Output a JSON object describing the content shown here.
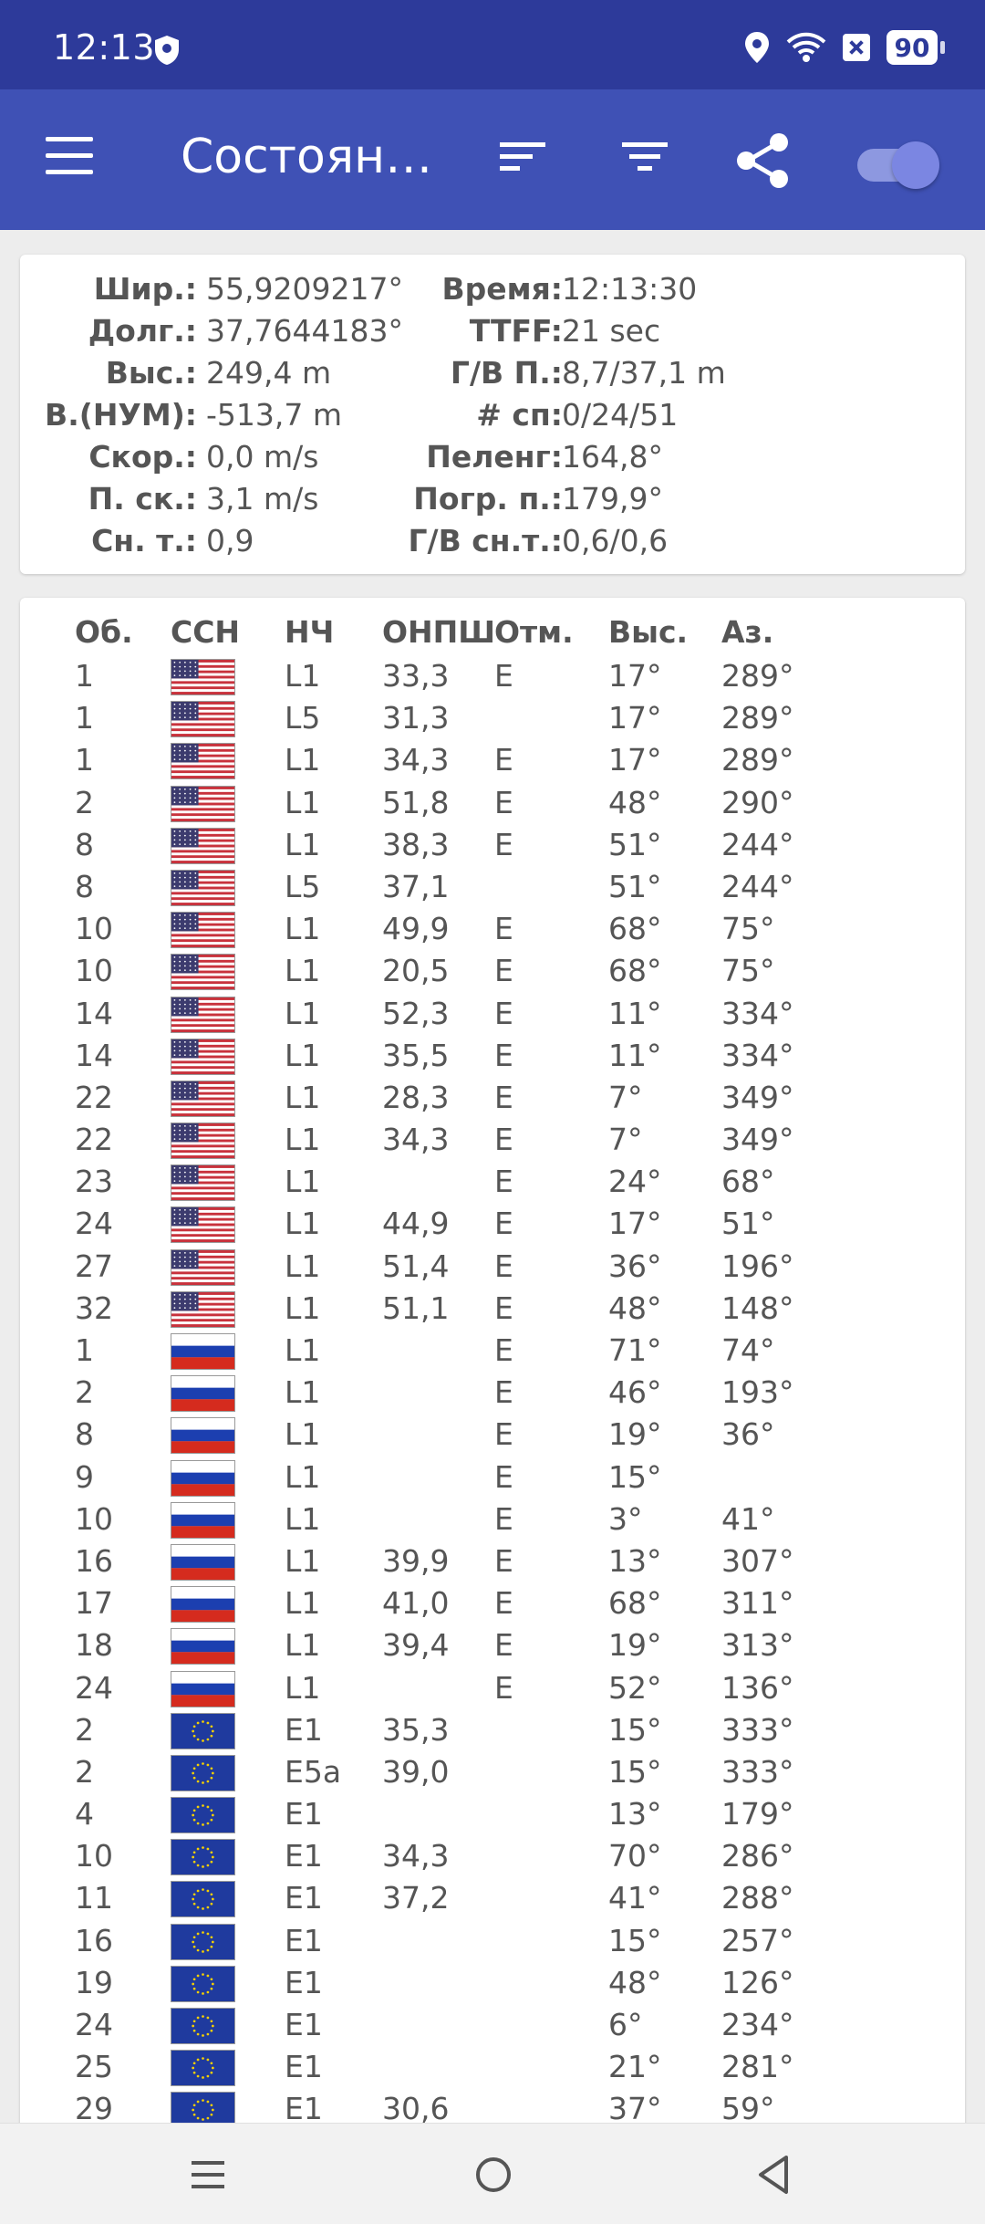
{
  "status_bar": {
    "time": "12:13",
    "battery": "90",
    "icons": [
      "shield-icon",
      "location-icon",
      "wifi-icon",
      "close-box-icon",
      "battery-icon"
    ]
  },
  "app_bar": {
    "title": "Состоян…",
    "icons": [
      "menu-icon",
      "sort-icon",
      "filter-icon",
      "share-icon",
      "toggle-switch"
    ],
    "toggle_on": true,
    "color": "#3f51b5"
  },
  "info": {
    "left": [
      {
        "label": "Шир.:",
        "value": "55,9209217°"
      },
      {
        "label": "Долг.:",
        "value": "37,7644183°"
      },
      {
        "label": "Выс.:",
        "value": "249,4 m"
      },
      {
        "label": "В.(НУМ):",
        "value": "-513,7 m"
      },
      {
        "label": "Скор.:",
        "value": "0,0 m/s"
      },
      {
        "label": "П. ск.:",
        "value": "3,1 m/s"
      },
      {
        "label": "Сн. т.:",
        "value": "0,9"
      }
    ],
    "right": [
      {
        "label": "Время:",
        "value": "12:13:30"
      },
      {
        "label": "TTFF:",
        "value": "21 sec"
      },
      {
        "label": "Г/В П.:",
        "value": "8,7/37,1 m"
      },
      {
        "label": "# сп:",
        "value": "0/24/51"
      },
      {
        "label": "Пеленг:",
        "value": "164,8°"
      },
      {
        "label": "Погр. п.:",
        "value": "179,9°"
      },
      {
        "label": "Г/В сн.т.:",
        "value": "0,6/0,6"
      }
    ]
  },
  "table": {
    "headers": [
      "Об.",
      "ССН",
      "НЧ",
      "ОНПШ",
      "Отм.",
      "Выс.",
      "Аз."
    ],
    "rows": [
      {
        "id": "1",
        "flag": "us",
        "freq": "L1",
        "cn0": "33,3",
        "flags": "E",
        "elev": "17°",
        "az": "289°"
      },
      {
        "id": "1",
        "flag": "us",
        "freq": "L5",
        "cn0": "31,3",
        "flags": "",
        "elev": "17°",
        "az": "289°"
      },
      {
        "id": "1",
        "flag": "us",
        "freq": "L1",
        "cn0": "34,3",
        "flags": "E",
        "elev": "17°",
        "az": "289°"
      },
      {
        "id": "2",
        "flag": "us",
        "freq": "L1",
        "cn0": "51,8",
        "flags": "E",
        "elev": "48°",
        "az": "290°"
      },
      {
        "id": "8",
        "flag": "us",
        "freq": "L1",
        "cn0": "38,3",
        "flags": "E",
        "elev": "51°",
        "az": "244°"
      },
      {
        "id": "8",
        "flag": "us",
        "freq": "L5",
        "cn0": "37,1",
        "flags": "",
        "elev": "51°",
        "az": "244°"
      },
      {
        "id": "10",
        "flag": "us",
        "freq": "L1",
        "cn0": "49,9",
        "flags": "E",
        "elev": "68°",
        "az": "75°"
      },
      {
        "id": "10",
        "flag": "us",
        "freq": "L1",
        "cn0": "20,5",
        "flags": "E",
        "elev": "68°",
        "az": "75°"
      },
      {
        "id": "14",
        "flag": "us",
        "freq": "L1",
        "cn0": "52,3",
        "flags": "E",
        "elev": "11°",
        "az": "334°"
      },
      {
        "id": "14",
        "flag": "us",
        "freq": "L1",
        "cn0": "35,5",
        "flags": "E",
        "elev": "11°",
        "az": "334°"
      },
      {
        "id": "22",
        "flag": "us",
        "freq": "L1",
        "cn0": "28,3",
        "flags": "E",
        "elev": "7°",
        "az": "349°"
      },
      {
        "id": "22",
        "flag": "us",
        "freq": "L1",
        "cn0": "34,3",
        "flags": "E",
        "elev": "7°",
        "az": "349°"
      },
      {
        "id": "23",
        "flag": "us",
        "freq": "L1",
        "cn0": "",
        "flags": "E",
        "elev": "24°",
        "az": "68°"
      },
      {
        "id": "24",
        "flag": "us",
        "freq": "L1",
        "cn0": "44,9",
        "flags": "E",
        "elev": "17°",
        "az": "51°"
      },
      {
        "id": "27",
        "flag": "us",
        "freq": "L1",
        "cn0": "51,4",
        "flags": "E",
        "elev": "36°",
        "az": "196°"
      },
      {
        "id": "32",
        "flag": "us",
        "freq": "L1",
        "cn0": "51,1",
        "flags": "E",
        "elev": "48°",
        "az": "148°"
      },
      {
        "id": "1",
        "flag": "ru",
        "freq": "L1",
        "cn0": "",
        "flags": "E",
        "elev": "71°",
        "az": "74°"
      },
      {
        "id": "2",
        "flag": "ru",
        "freq": "L1",
        "cn0": "",
        "flags": "E",
        "elev": "46°",
        "az": "193°"
      },
      {
        "id": "8",
        "flag": "ru",
        "freq": "L1",
        "cn0": "",
        "flags": "E",
        "elev": "19°",
        "az": "36°"
      },
      {
        "id": "9",
        "flag": "ru",
        "freq": "L1",
        "cn0": "",
        "flags": "E",
        "elev": "15°",
        "az": ""
      },
      {
        "id": "10",
        "flag": "ru",
        "freq": "L1",
        "cn0": "",
        "flags": "E",
        "elev": "3°",
        "az": "41°"
      },
      {
        "id": "16",
        "flag": "ru",
        "freq": "L1",
        "cn0": "39,9",
        "flags": "E",
        "elev": "13°",
        "az": "307°"
      },
      {
        "id": "17",
        "flag": "ru",
        "freq": "L1",
        "cn0": "41,0",
        "flags": "E",
        "elev": "68°",
        "az": "311°"
      },
      {
        "id": "18",
        "flag": "ru",
        "freq": "L1",
        "cn0": "39,4",
        "flags": "E",
        "elev": "19°",
        "az": "313°"
      },
      {
        "id": "24",
        "flag": "ru",
        "freq": "L1",
        "cn0": "",
        "flags": "E",
        "elev": "52°",
        "az": "136°"
      },
      {
        "id": "2",
        "flag": "eu",
        "freq": "E1",
        "cn0": "35,3",
        "flags": "",
        "elev": "15°",
        "az": "333°"
      },
      {
        "id": "2",
        "flag": "eu",
        "freq": "E5a",
        "cn0": "39,0",
        "flags": "",
        "elev": "15°",
        "az": "333°"
      },
      {
        "id": "4",
        "flag": "eu",
        "freq": "E1",
        "cn0": "",
        "flags": "",
        "elev": "13°",
        "az": "179°"
      },
      {
        "id": "10",
        "flag": "eu",
        "freq": "E1",
        "cn0": "34,3",
        "flags": "",
        "elev": "70°",
        "az": "286°"
      },
      {
        "id": "11",
        "flag": "eu",
        "freq": "E1",
        "cn0": "37,2",
        "flags": "",
        "elev": "41°",
        "az": "288°"
      },
      {
        "id": "16",
        "flag": "eu",
        "freq": "E1",
        "cn0": "",
        "flags": "",
        "elev": "15°",
        "az": "257°"
      },
      {
        "id": "19",
        "flag": "eu",
        "freq": "E1",
        "cn0": "",
        "flags": "",
        "elev": "48°",
        "az": "126°"
      },
      {
        "id": "24",
        "flag": "eu",
        "freq": "E1",
        "cn0": "",
        "flags": "",
        "elev": "6°",
        "az": "234°"
      },
      {
        "id": "25",
        "flag": "eu",
        "freq": "E1",
        "cn0": "",
        "flags": "",
        "elev": "21°",
        "az": "281°"
      },
      {
        "id": "29",
        "flag": "eu",
        "freq": "E1",
        "cn0": "30,6",
        "flags": "",
        "elev": "37°",
        "az": "59°"
      },
      {
        "id": "",
        "flag": "eu",
        "freq": "",
        "cn0": "",
        "flags": "",
        "elev": "",
        "az": ""
      }
    ]
  },
  "nav_bar": {
    "icons": [
      "recent-apps-icon",
      "home-icon",
      "back-icon"
    ]
  }
}
